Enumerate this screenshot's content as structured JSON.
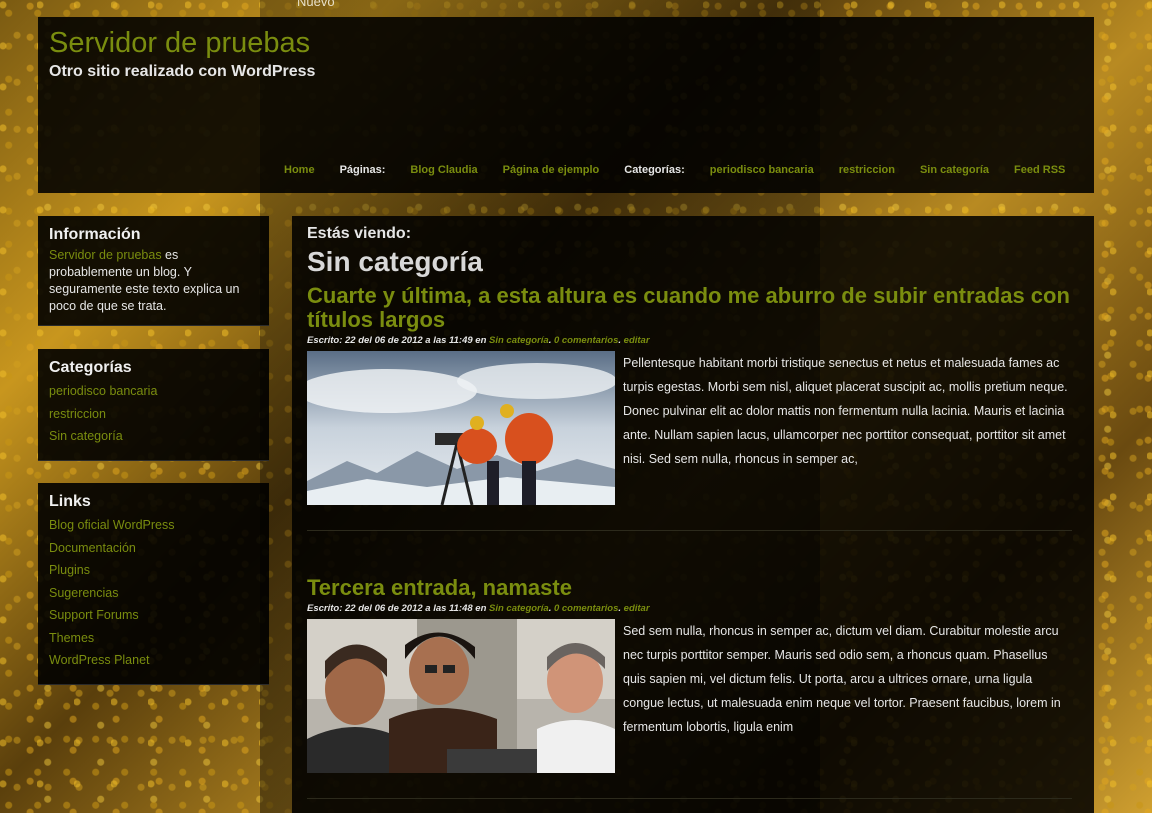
{
  "top_link": "Nuevo",
  "site": {
    "title": "Servidor de pruebas",
    "description": "Otro sitio realizado con WordPress"
  },
  "nav": [
    {
      "label": "Home",
      "type": "link"
    },
    {
      "label": "Páginas:",
      "type": "header"
    },
    {
      "label": "Blog Claudia",
      "type": "link"
    },
    {
      "label": "Página de ejemplo",
      "type": "link"
    },
    {
      "label": "Categorías:",
      "type": "header"
    },
    {
      "label": "periodisco bancaria",
      "type": "link"
    },
    {
      "label": "restriccion",
      "type": "link"
    },
    {
      "label": "Sin categoría",
      "type": "link"
    },
    {
      "label": "Feed RSS",
      "type": "link"
    }
  ],
  "sidebar": {
    "info": {
      "title": "Información",
      "link": "Servidor de pruebas",
      "text": " es probablemente un blog. Y seguramente este texto explica un poco de que se trata."
    },
    "categories": {
      "title": "Categorías",
      "items": [
        "periodisco bancaria",
        "restriccion",
        "Sin categoría"
      ]
    },
    "links": {
      "title": "Links",
      "items": [
        "Blog oficial WordPress",
        "Documentación",
        "Plugins",
        "Sugerencias",
        "Support Forums",
        "Themes",
        "WordPress Planet"
      ]
    }
  },
  "content": {
    "viewing_label": "Estás viendo:",
    "viewing_category": "Sin categoría",
    "posts": [
      {
        "title": "Cuarte y última, a esta altura es cuando me aburro de subir entradas con títulos largos",
        "meta_prefix": "Escrito: 22 del 06 de 2012 a las 11:49 en ",
        "category": "Sin categoría",
        "comments": "0 comentarios",
        "edit": "editar",
        "excerpt": "Pellentesque habitant morbi tristique senectus et netus et malesuada fames ac turpis egestas. Morbi sem nisl, aliquet placerat suscipit ac, mollis pretium neque. Donec pulvinar elit ac dolor mattis non fermentum nulla lacinia. Mauris et lacinia ante. Nullam sapien lacus, ullamcorper nec porttitor consequat, porttitor sit amet nisi. Sed sem nulla, rhoncus in semper ac,"
      },
      {
        "title": "Tercera entrada, namaste",
        "meta_prefix": "Escrito: 22 del 06 de 2012 a las 11:48 en ",
        "category": "Sin categoría",
        "comments": "0 comentarios",
        "edit": "editar",
        "excerpt": "Sed sem nulla, rhoncus in semper ac, dictum vel diam. Curabitur molestie arcu nec turpis porttitor semper. Mauris sed odio sem, a rhoncus quam. Phasellus quis sapien mi, vel dictum felis. Ut porta, arcu a ultrices ornare, urna ligula congue lectus, ut malesuada enim neque vel tortor. Praesent faucibus, lorem in fermentum lobortis, ligula enim"
      }
    ]
  },
  "colors": {
    "link": "#7a8d0f",
    "text": "#e6e6e6",
    "panel": "#000000"
  }
}
